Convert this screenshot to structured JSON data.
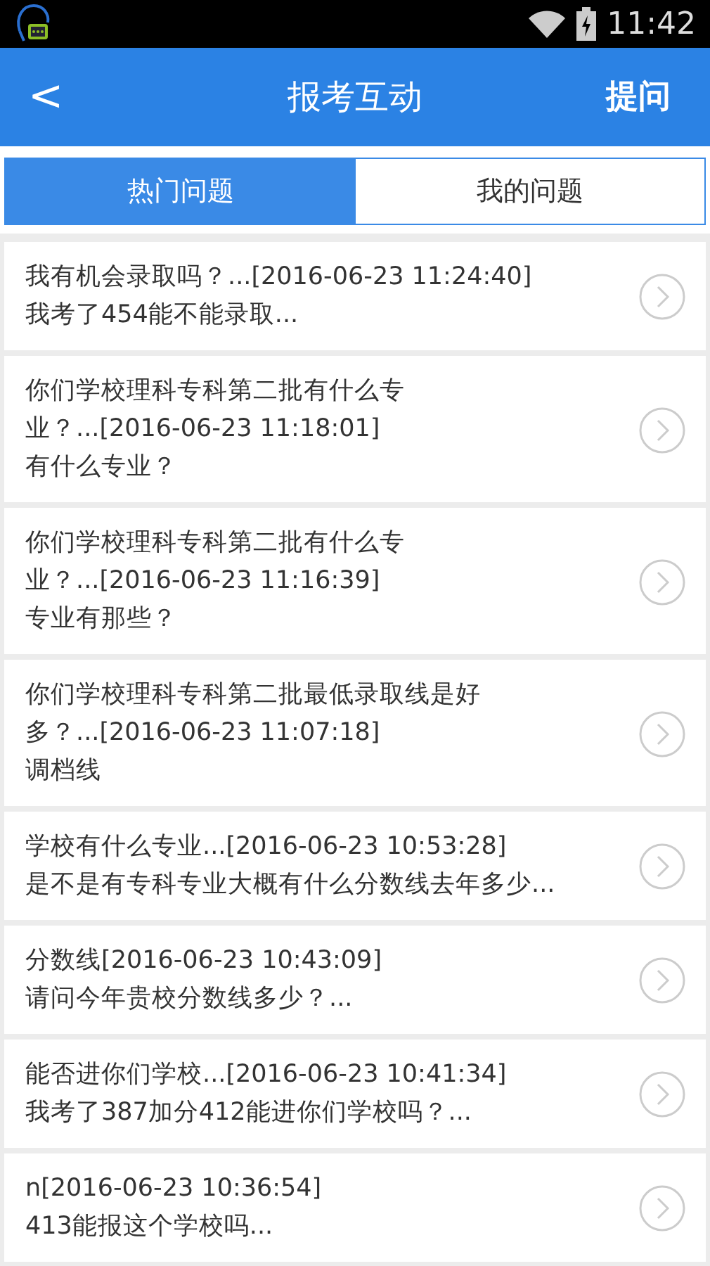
{
  "status_bar": {
    "time": "11:42"
  },
  "header": {
    "back": "<",
    "title": "报考互动",
    "action": "提问"
  },
  "tabs": [
    {
      "label": "热门问题",
      "selected": true
    },
    {
      "label": "我的问题",
      "selected": false
    }
  ],
  "questions": [
    {
      "title_lines": [
        "我有机会录取吗？...[2016-06-23 11:24:40]"
      ],
      "preview": "我考了454能不能录取..."
    },
    {
      "title_lines": [
        "你们学校理科专科第二批有什么专",
        "业？...[2016-06-23 11:18:01]"
      ],
      "preview": "有什么专业？"
    },
    {
      "title_lines": [
        "你们学校理科专科第二批有什么专",
        "业？...[2016-06-23 11:16:39]"
      ],
      "preview": "专业有那些？"
    },
    {
      "title_lines": [
        "你们学校理科专科第二批最低录取线是好",
        "多？...[2016-06-23 11:07:18]"
      ],
      "preview": "调档线"
    },
    {
      "title_lines": [
        "学校有什么专业...[2016-06-23 10:53:28]"
      ],
      "preview": "是不是有专科专业大概有什么分数线去年多少..."
    },
    {
      "title_lines": [
        "分数线[2016-06-23 10:43:09]"
      ],
      "preview": "请问今年贵校分数线多少？..."
    },
    {
      "title_lines": [
        "能否进你们学校...[2016-06-23 10:41:34]"
      ],
      "preview": "我考了387加分412能进你们学校吗？..."
    },
    {
      "title_lines": [
        "n[2016-06-23 10:36:54]"
      ],
      "preview": "413能报这个学校吗..."
    }
  ]
}
